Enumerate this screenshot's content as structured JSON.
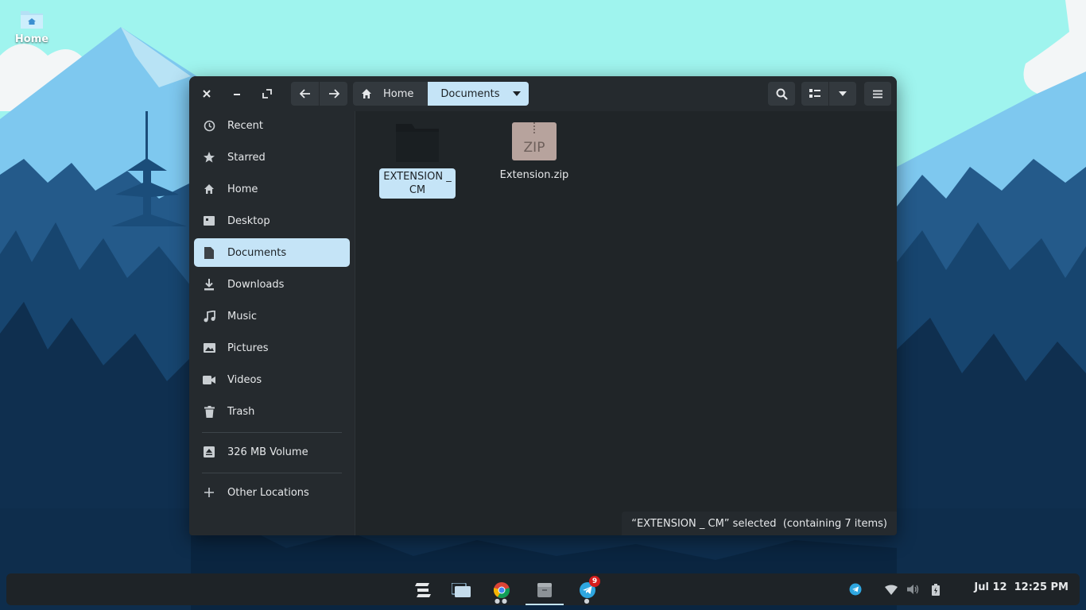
{
  "desktop": {
    "home_icon_label": "Home"
  },
  "window": {
    "path": {
      "home_label": "Home",
      "current_label": "Documents"
    },
    "sidebar": {
      "items": [
        {
          "label": "Recent",
          "icon": "clock-icon"
        },
        {
          "label": "Starred",
          "icon": "star-icon"
        },
        {
          "label": "Home",
          "icon": "home-icon"
        },
        {
          "label": "Desktop",
          "icon": "desktop-icon"
        },
        {
          "label": "Documents",
          "icon": "document-icon",
          "active": true
        },
        {
          "label": "Downloads",
          "icon": "download-icon"
        },
        {
          "label": "Music",
          "icon": "music-icon"
        },
        {
          "label": "Pictures",
          "icon": "picture-icon"
        },
        {
          "label": "Videos",
          "icon": "video-icon"
        },
        {
          "label": "Trash",
          "icon": "trash-icon"
        }
      ],
      "volume_label": "326 MB Volume",
      "other_locations_label": "Other Locations"
    },
    "files": [
      {
        "name": "EXTENSION _ CM",
        "type": "folder",
        "selected": true
      },
      {
        "name": "Extension.zip",
        "type": "zip",
        "type_label": "ZIP"
      }
    ],
    "status_text": "“EXTENSION _ CM” selected  (containing 7 items)"
  },
  "taskbar": {
    "telegram_badge": "9",
    "clock": "Jul 12  12:25 PM"
  },
  "colors": {
    "accent": "#c5e4f7",
    "window_bg": "#202528",
    "headerbar_bg": "#252a2e",
    "button_bg": "#33393e",
    "badge": "#d61c1c"
  }
}
